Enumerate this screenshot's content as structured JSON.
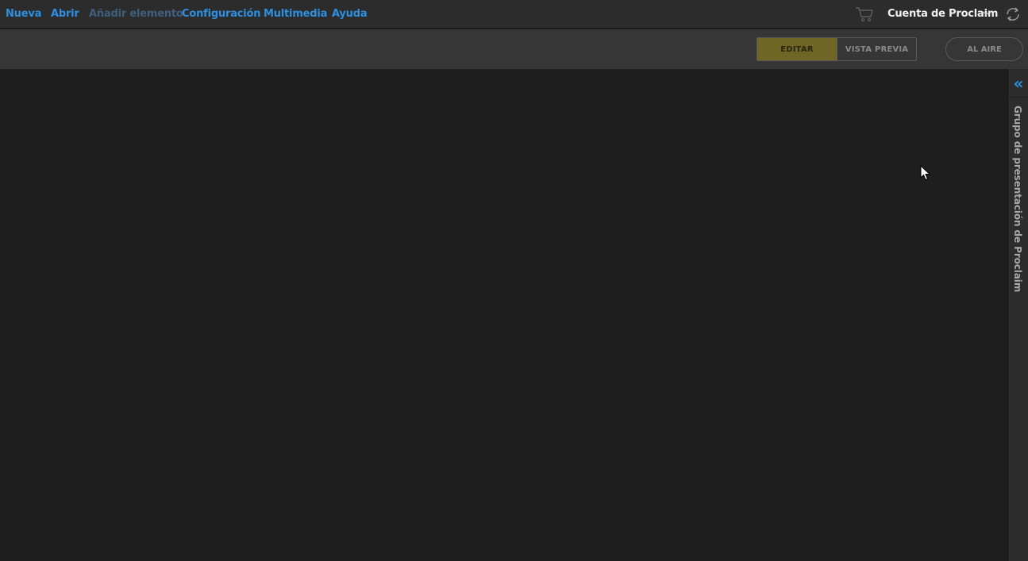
{
  "menu": {
    "items": [
      {
        "label": "Nueva",
        "enabled": true
      },
      {
        "label": "Abrir",
        "enabled": true
      },
      {
        "label": "Añadir elemento",
        "enabled": false
      },
      {
        "label": "Configuración",
        "enabled": true
      },
      {
        "label": "Multimedia",
        "enabled": true
      },
      {
        "label": "Ayuda",
        "enabled": true
      }
    ],
    "account_label": "Cuenta de Proclaim"
  },
  "toolbar": {
    "edit_label": "EDITAR",
    "preview_label": "VISTA PREVIA",
    "on_air_label": "AL AIRE",
    "active_mode": "EDITAR"
  },
  "side_panel": {
    "label": "Grupo de presentación de Proclaim",
    "collapse_glyph": "«"
  },
  "colors": {
    "link": "#2e8fe0",
    "disabled_link": "#3f5f7c",
    "edit_active": "#6f6524",
    "background": "#1e1e1e"
  },
  "icons": [
    "cart-icon",
    "chevron-down-icon",
    "sync-icon",
    "double-chevron-left-icon",
    "mouse-cursor-icon"
  ]
}
